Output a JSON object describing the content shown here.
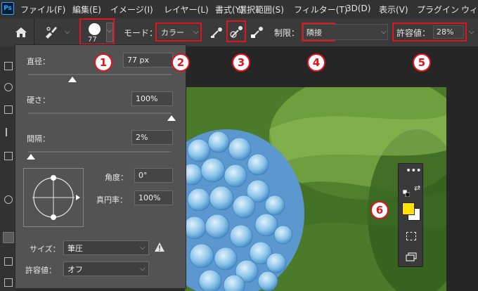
{
  "app": {
    "logo": "Ps"
  },
  "menu": [
    "ファイル(F)",
    "編集(E)",
    "イメージ(I)",
    "レイヤー(L)",
    "書式(Y)",
    "選択範囲(S)",
    "フィルター(T)",
    "3D(D)",
    "表示(V)",
    "プラグイン",
    "ウィン"
  ],
  "options": {
    "brush_size": "77",
    "mode_label": "モード：",
    "mode_value": "カラー",
    "limit_label": "制限：",
    "limit_value": "隣接",
    "tolerance_label": "許容値：",
    "tolerance_value": "28%"
  },
  "popup": {
    "diameter_label": "直径：",
    "diameter_value": "77 px",
    "diameter_level": 0.31,
    "hardness_label": "硬さ：",
    "hardness_value": "100%",
    "hardness_level": 1.0,
    "spacing_label": "間隔：",
    "spacing_value": "2%",
    "spacing_level": 0.02,
    "angle_label": "角度：",
    "angle_value": "0°",
    "roundness_label": "真円率：",
    "roundness_value": "100%",
    "size_label": "サイズ：",
    "size_value": "筆圧",
    "tolerance_label": "許容値：",
    "tolerance_value": "オフ"
  },
  "callouts": [
    "1",
    "2",
    "3",
    "4",
    "5",
    "6"
  ],
  "colors": {
    "foreground": "#ffe000",
    "background": "#ffffff",
    "callout": "#e0141e"
  },
  "icons": [
    "home-icon",
    "brush-tool-icon",
    "sample-icon",
    "sample-once-icon",
    "background-swatch-icon",
    "warning-icon",
    "more-icon",
    "swap-colors-icon",
    "quick-mask-icon",
    "screen-mode-icon"
  ]
}
